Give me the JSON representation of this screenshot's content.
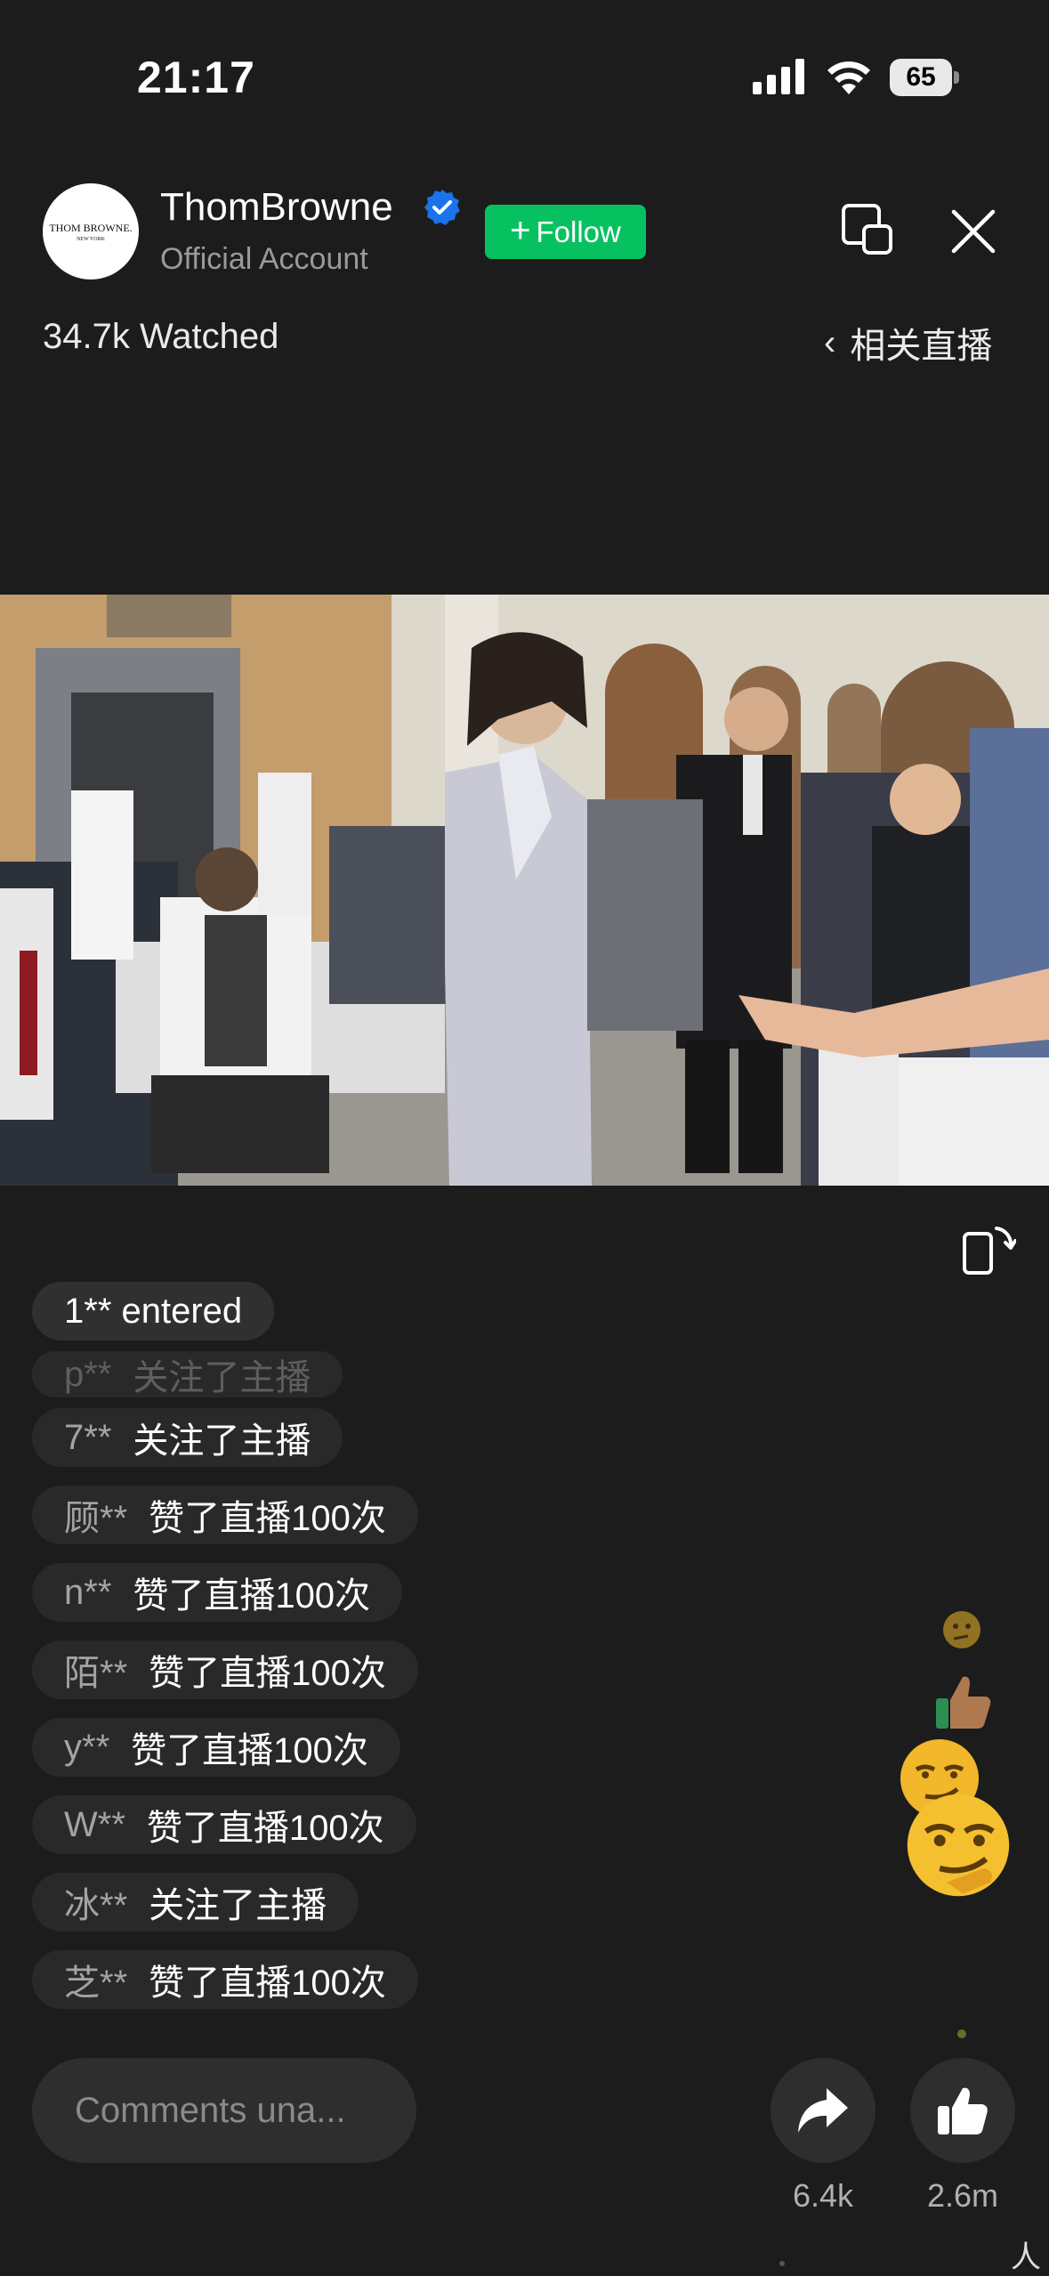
{
  "status_bar": {
    "time": "21:17",
    "battery": "65"
  },
  "header": {
    "avatar_text_line1": "THOM BROWNE.",
    "avatar_text_line2": "NEW YORK",
    "account_name": "ThomBrowne",
    "account_subtitle": "Official Account",
    "follow_label": "Follow",
    "watched": "34.7k Watched",
    "related_label": "相关直播"
  },
  "feed": [
    {
      "user": "",
      "action": "1** entered"
    },
    {
      "user": "p**",
      "action": "关注了主播"
    },
    {
      "user": "7**",
      "action": "关注了主播"
    },
    {
      "user": "顾**",
      "action": "赞了直播100次"
    },
    {
      "user": "n**",
      "action": "赞了直播100次"
    },
    {
      "user": "陌**",
      "action": "赞了直播100次"
    },
    {
      "user": "y**",
      "action": "赞了直播100次"
    },
    {
      "user": "W**",
      "action": "赞了直播100次"
    },
    {
      "user": "冰**",
      "action": "关注了主播"
    },
    {
      "user": "芝**",
      "action": "赞了直播100次"
    }
  ],
  "floating_emojis": [
    "thinking-face",
    "thumbs-up",
    "smirking-face",
    "smirking-face"
  ],
  "bottom": {
    "comment_placeholder": "Comments una...",
    "share_count": "6.4k",
    "like_count": "2.6m",
    "corner_glyph": "人"
  },
  "colors": {
    "follow_green": "#07c160",
    "verified_blue": "#1a73e8",
    "background": "#1c1c1c"
  }
}
